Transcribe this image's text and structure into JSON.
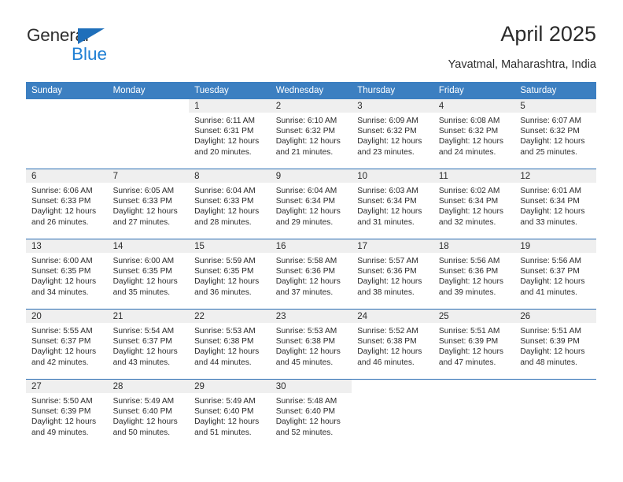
{
  "brand": {
    "name_part1": "General",
    "name_part2": "Blue",
    "triangle_color": "#1f6fba",
    "blue_color": "#1f7fd4"
  },
  "header": {
    "title": "April 2025",
    "subtitle": "Yavatmal, Maharashtra, India"
  },
  "theme": {
    "header_bg": "#3c7fc1",
    "row_divider": "#2a6db3",
    "daynum_band_bg": "#efefef",
    "text": "#2b2b2b"
  },
  "weekday_headers": [
    "Sunday",
    "Monday",
    "Tuesday",
    "Wednesday",
    "Thursday",
    "Friday",
    "Saturday"
  ],
  "labels": {
    "sunrise_prefix": "Sunrise:",
    "sunset_prefix": "Sunset:",
    "daylight_prefix": "Daylight:"
  },
  "weeks": [
    [
      {
        "day": "",
        "empty": true
      },
      {
        "day": "",
        "empty": true
      },
      {
        "day": "1",
        "sunrise": "Sunrise: 6:11 AM",
        "sunset": "Sunset: 6:31 PM",
        "daylight": "Daylight: 12 hours and 20 minutes."
      },
      {
        "day": "2",
        "sunrise": "Sunrise: 6:10 AM",
        "sunset": "Sunset: 6:32 PM",
        "daylight": "Daylight: 12 hours and 21 minutes."
      },
      {
        "day": "3",
        "sunrise": "Sunrise: 6:09 AM",
        "sunset": "Sunset: 6:32 PM",
        "daylight": "Daylight: 12 hours and 23 minutes."
      },
      {
        "day": "4",
        "sunrise": "Sunrise: 6:08 AM",
        "sunset": "Sunset: 6:32 PM",
        "daylight": "Daylight: 12 hours and 24 minutes."
      },
      {
        "day": "5",
        "sunrise": "Sunrise: 6:07 AM",
        "sunset": "Sunset: 6:32 PM",
        "daylight": "Daylight: 12 hours and 25 minutes."
      }
    ],
    [
      {
        "day": "6",
        "sunrise": "Sunrise: 6:06 AM",
        "sunset": "Sunset: 6:33 PM",
        "daylight": "Daylight: 12 hours and 26 minutes."
      },
      {
        "day": "7",
        "sunrise": "Sunrise: 6:05 AM",
        "sunset": "Sunset: 6:33 PM",
        "daylight": "Daylight: 12 hours and 27 minutes."
      },
      {
        "day": "8",
        "sunrise": "Sunrise: 6:04 AM",
        "sunset": "Sunset: 6:33 PM",
        "daylight": "Daylight: 12 hours and 28 minutes."
      },
      {
        "day": "9",
        "sunrise": "Sunrise: 6:04 AM",
        "sunset": "Sunset: 6:34 PM",
        "daylight": "Daylight: 12 hours and 29 minutes."
      },
      {
        "day": "10",
        "sunrise": "Sunrise: 6:03 AM",
        "sunset": "Sunset: 6:34 PM",
        "daylight": "Daylight: 12 hours and 31 minutes."
      },
      {
        "day": "11",
        "sunrise": "Sunrise: 6:02 AM",
        "sunset": "Sunset: 6:34 PM",
        "daylight": "Daylight: 12 hours and 32 minutes."
      },
      {
        "day": "12",
        "sunrise": "Sunrise: 6:01 AM",
        "sunset": "Sunset: 6:34 PM",
        "daylight": "Daylight: 12 hours and 33 minutes."
      }
    ],
    [
      {
        "day": "13",
        "sunrise": "Sunrise: 6:00 AM",
        "sunset": "Sunset: 6:35 PM",
        "daylight": "Daylight: 12 hours and 34 minutes."
      },
      {
        "day": "14",
        "sunrise": "Sunrise: 6:00 AM",
        "sunset": "Sunset: 6:35 PM",
        "daylight": "Daylight: 12 hours and 35 minutes."
      },
      {
        "day": "15",
        "sunrise": "Sunrise: 5:59 AM",
        "sunset": "Sunset: 6:35 PM",
        "daylight": "Daylight: 12 hours and 36 minutes."
      },
      {
        "day": "16",
        "sunrise": "Sunrise: 5:58 AM",
        "sunset": "Sunset: 6:36 PM",
        "daylight": "Daylight: 12 hours and 37 minutes."
      },
      {
        "day": "17",
        "sunrise": "Sunrise: 5:57 AM",
        "sunset": "Sunset: 6:36 PM",
        "daylight": "Daylight: 12 hours and 38 minutes."
      },
      {
        "day": "18",
        "sunrise": "Sunrise: 5:56 AM",
        "sunset": "Sunset: 6:36 PM",
        "daylight": "Daylight: 12 hours and 39 minutes."
      },
      {
        "day": "19",
        "sunrise": "Sunrise: 5:56 AM",
        "sunset": "Sunset: 6:37 PM",
        "daylight": "Daylight: 12 hours and 41 minutes."
      }
    ],
    [
      {
        "day": "20",
        "sunrise": "Sunrise: 5:55 AM",
        "sunset": "Sunset: 6:37 PM",
        "daylight": "Daylight: 12 hours and 42 minutes."
      },
      {
        "day": "21",
        "sunrise": "Sunrise: 5:54 AM",
        "sunset": "Sunset: 6:37 PM",
        "daylight": "Daylight: 12 hours and 43 minutes."
      },
      {
        "day": "22",
        "sunrise": "Sunrise: 5:53 AM",
        "sunset": "Sunset: 6:38 PM",
        "daylight": "Daylight: 12 hours and 44 minutes."
      },
      {
        "day": "23",
        "sunrise": "Sunrise: 5:53 AM",
        "sunset": "Sunset: 6:38 PM",
        "daylight": "Daylight: 12 hours and 45 minutes."
      },
      {
        "day": "24",
        "sunrise": "Sunrise: 5:52 AM",
        "sunset": "Sunset: 6:38 PM",
        "daylight": "Daylight: 12 hours and 46 minutes."
      },
      {
        "day": "25",
        "sunrise": "Sunrise: 5:51 AM",
        "sunset": "Sunset: 6:39 PM",
        "daylight": "Daylight: 12 hours and 47 minutes."
      },
      {
        "day": "26",
        "sunrise": "Sunrise: 5:51 AM",
        "sunset": "Sunset: 6:39 PM",
        "daylight": "Daylight: 12 hours and 48 minutes."
      }
    ],
    [
      {
        "day": "27",
        "sunrise": "Sunrise: 5:50 AM",
        "sunset": "Sunset: 6:39 PM",
        "daylight": "Daylight: 12 hours and 49 minutes."
      },
      {
        "day": "28",
        "sunrise": "Sunrise: 5:49 AM",
        "sunset": "Sunset: 6:40 PM",
        "daylight": "Daylight: 12 hours and 50 minutes."
      },
      {
        "day": "29",
        "sunrise": "Sunrise: 5:49 AM",
        "sunset": "Sunset: 6:40 PM",
        "daylight": "Daylight: 12 hours and 51 minutes."
      },
      {
        "day": "30",
        "sunrise": "Sunrise: 5:48 AM",
        "sunset": "Sunset: 6:40 PM",
        "daylight": "Daylight: 12 hours and 52 minutes."
      },
      {
        "day": "",
        "empty": true
      },
      {
        "day": "",
        "empty": true
      },
      {
        "day": "",
        "empty": true
      }
    ]
  ]
}
